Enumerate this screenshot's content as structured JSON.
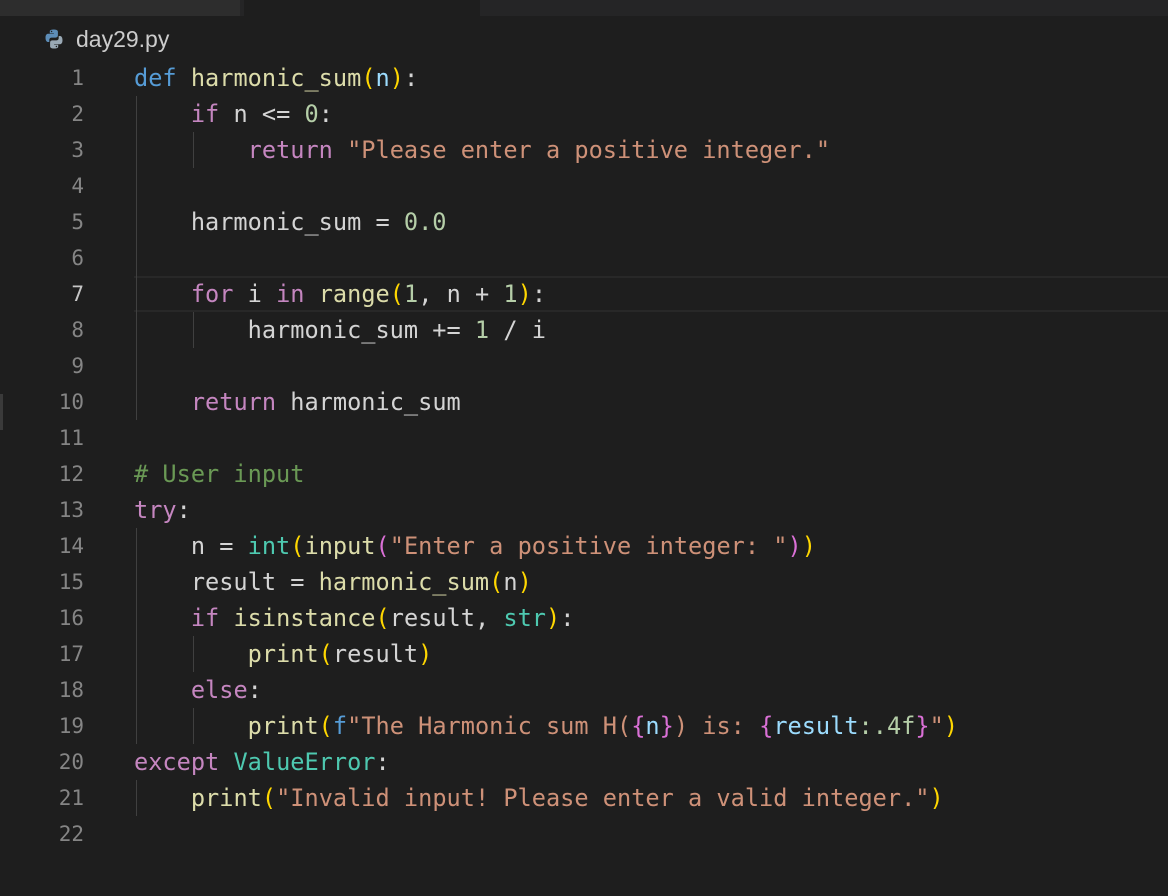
{
  "file": {
    "icon": "python-icon",
    "name": "day29.py"
  },
  "editor": {
    "active_line": 7,
    "lines": [
      {
        "num": "1",
        "code": "def harmonic_sum(n):"
      },
      {
        "num": "2",
        "code": "    if n <= 0:"
      },
      {
        "num": "3",
        "code": "        return \"Please enter a positive integer.\""
      },
      {
        "num": "4",
        "code": ""
      },
      {
        "num": "5",
        "code": "    harmonic_sum = 0.0"
      },
      {
        "num": "6",
        "code": ""
      },
      {
        "num": "7",
        "code": "    for i in range(1, n + 1):"
      },
      {
        "num": "8",
        "code": "        harmonic_sum += 1 / i"
      },
      {
        "num": "9",
        "code": ""
      },
      {
        "num": "10",
        "code": "    return harmonic_sum"
      },
      {
        "num": "11",
        "code": ""
      },
      {
        "num": "12",
        "code": "# User input"
      },
      {
        "num": "13",
        "code": "try:"
      },
      {
        "num": "14",
        "code": "    n = int(input(\"Enter a positive integer: \"))"
      },
      {
        "num": "15",
        "code": "    result = harmonic_sum(n)"
      },
      {
        "num": "16",
        "code": "    if isinstance(result, str):"
      },
      {
        "num": "17",
        "code": "        print(result)"
      },
      {
        "num": "18",
        "code": "    else:"
      },
      {
        "num": "19",
        "code": "        print(f\"The Harmonic sum H({n}) is: {result:.4f}\")"
      },
      {
        "num": "20",
        "code": "except ValueError:"
      },
      {
        "num": "21",
        "code": "    print(\"Invalid input! Please enter a valid integer.\")"
      },
      {
        "num": "22",
        "code": ""
      }
    ]
  },
  "colors": {
    "background": "#1e1e1e",
    "keyword_control": "#c586c0",
    "keyword_def": "#569cd6",
    "function": "#dcdcaa",
    "string": "#ce9178",
    "number": "#b5cea8",
    "builtin_class": "#4ec9b0",
    "comment": "#6a9955",
    "bracket_level1": "#ffd700",
    "bracket_level2": "#da70d6",
    "bracket_level3": "#179fff"
  }
}
